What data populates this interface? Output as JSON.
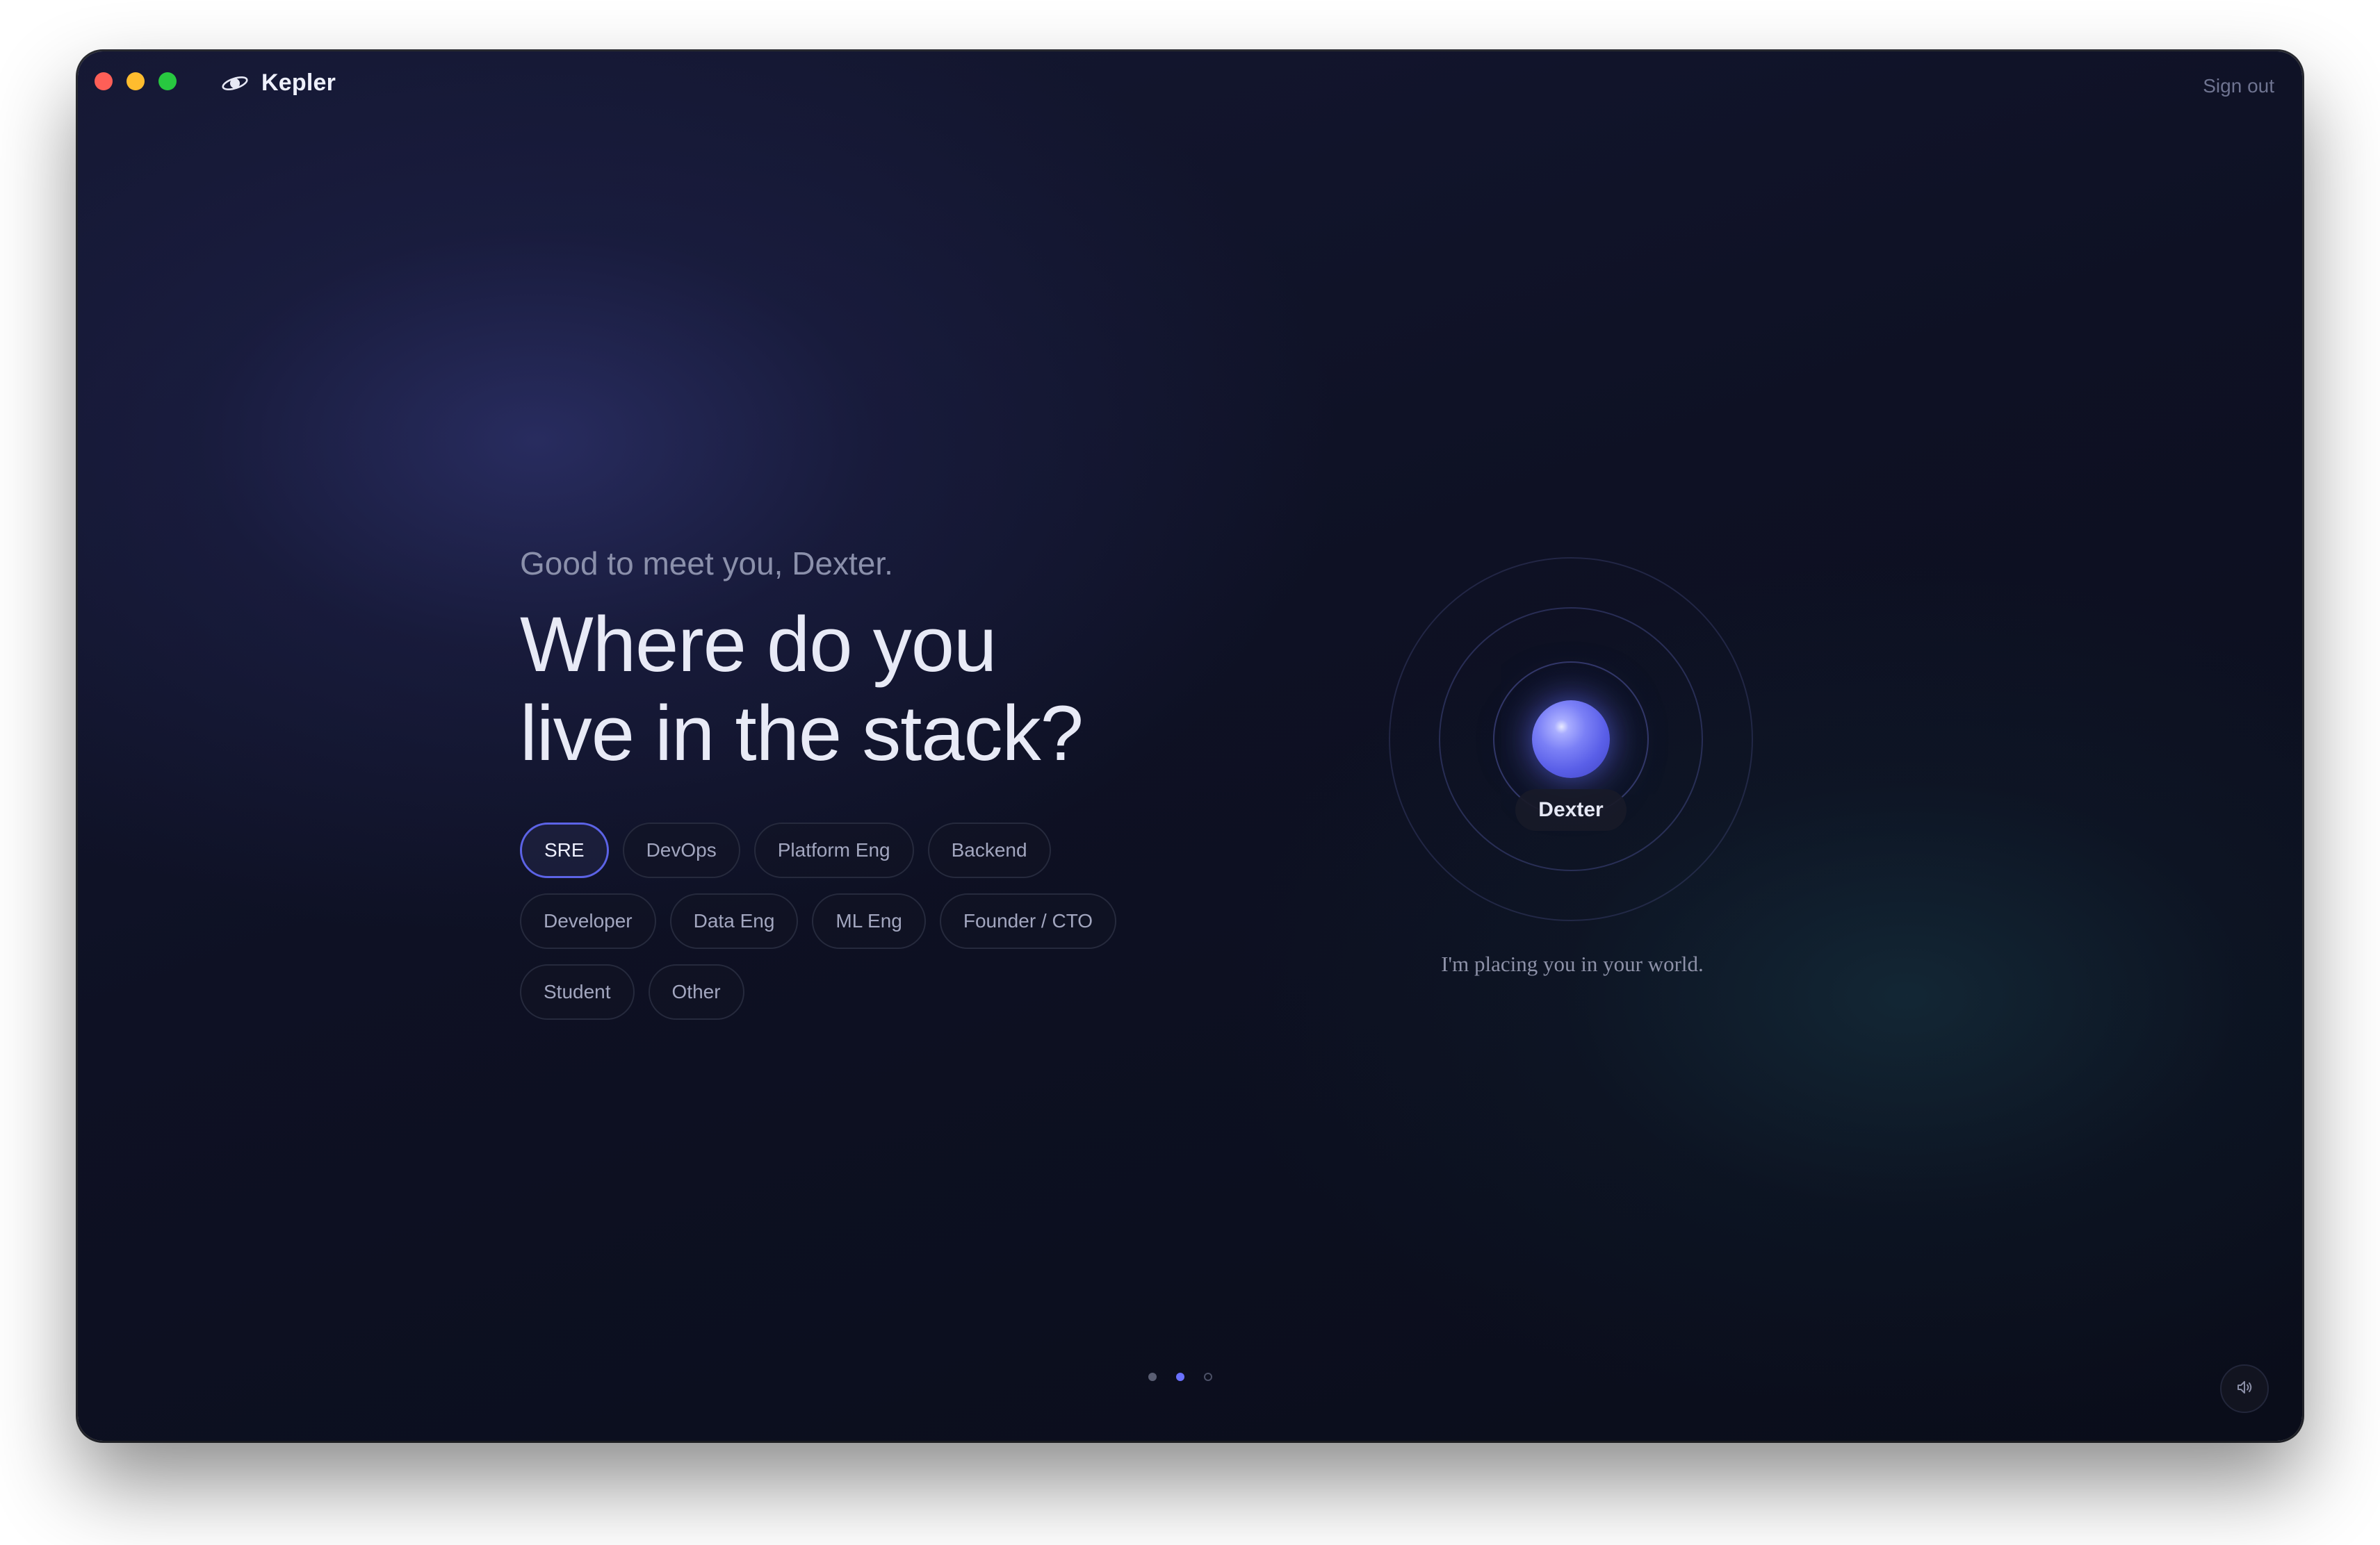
{
  "app": {
    "name": "Kepler",
    "logo_icon": "planet-ring-icon",
    "sign_out_label": "Sign out"
  },
  "window_controls": [
    "close",
    "minimize",
    "zoom"
  ],
  "onboarding": {
    "greeting": "Good to meet you, Dexter.",
    "headline_line1": "Where do you",
    "headline_line2": "live in the stack?",
    "roles": [
      {
        "label": "SRE",
        "selected": true
      },
      {
        "label": "DevOps",
        "selected": false
      },
      {
        "label": "Platform Eng",
        "selected": false
      },
      {
        "label": "Backend",
        "selected": false
      },
      {
        "label": "Developer",
        "selected": false
      },
      {
        "label": "Data Eng",
        "selected": false
      },
      {
        "label": "ML Eng",
        "selected": false
      },
      {
        "label": "Founder / CTO",
        "selected": false
      },
      {
        "label": "Student",
        "selected": false
      },
      {
        "label": "Other",
        "selected": false
      }
    ]
  },
  "avatar": {
    "name": "Dexter",
    "caption": "I'm placing you in your world."
  },
  "pagination": {
    "current_step": 2,
    "total_steps": 3
  },
  "sound_button": {
    "icon": "speaker-icon"
  },
  "colors": {
    "accent": "#5c63e6",
    "sphere": "#6a70f4",
    "text_primary": "#e8eaf6",
    "text_muted": "#8b90ab"
  }
}
